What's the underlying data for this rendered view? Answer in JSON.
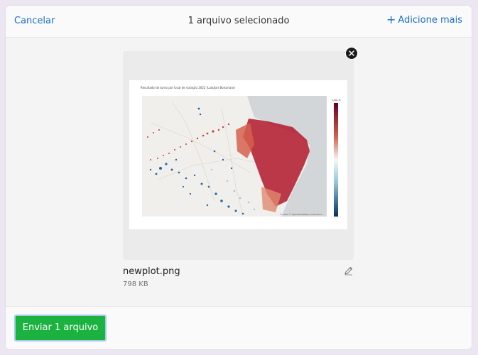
{
  "header": {
    "cancel_label": "Cancelar",
    "title": "1 arquivo selecionado",
    "add_more_label": "Adicione mais"
  },
  "file": {
    "name": "newplot.png",
    "size": "798 KB",
    "thumbnail_caption": "Resultado do turno por local de votação 2022 (Lula/Jair Bolsonaro)",
    "thumbnail_attribution": "© Carto © OpenStreetMap contributors",
    "thumbnail_colorbar_title": "Lula %"
  },
  "footer": {
    "upload_label": "Enviar 1 arquivo"
  },
  "colors": {
    "link": "#1c6ec7",
    "primary_button": "#1bb240",
    "map_red": "#b2182b",
    "map_blue": "#2166ac"
  },
  "icons": {
    "remove": "close-icon",
    "edit": "pencil-icon",
    "add": "plus-icon"
  }
}
